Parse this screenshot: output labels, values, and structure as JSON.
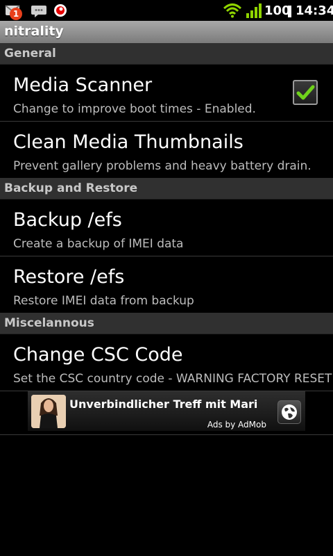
{
  "status_bar": {
    "notification_count": "1",
    "battery_level": "100",
    "time": "14:34",
    "icons": [
      "missed-call-icon",
      "message-icon",
      "vodafone-icon",
      "wifi-icon",
      "signal-icon",
      "battery-icon"
    ]
  },
  "app": {
    "title": "nitrality"
  },
  "sections": {
    "general": {
      "label": "General",
      "items": [
        {
          "title": "Media Scanner",
          "summary": "Change to improve boot times - Enabled.",
          "checked": true
        },
        {
          "title": "Clean Media Thumbnails",
          "summary": "Prevent gallery problems and heavy battery drain."
        }
      ]
    },
    "backup": {
      "label": "Backup and Restore",
      "items": [
        {
          "title": "Backup /efs",
          "summary": "Create a backup of IMEI data"
        },
        {
          "title": "Restore /efs",
          "summary": "Restore IMEI data from backup"
        }
      ]
    },
    "misc": {
      "label": "Miscelannous",
      "items": [
        {
          "title": "Change CSC Code",
          "summary": "Set the CSC country code - WARNING FACTORY RESET"
        }
      ]
    }
  },
  "ad": {
    "headline": "Unverbindlicher Treff mit Mari",
    "attribution": "Ads by AdMob"
  },
  "colors": {
    "checkmark": "#6fd21b",
    "accent_red": "#e8401c",
    "signal_green": "#8fd400"
  }
}
